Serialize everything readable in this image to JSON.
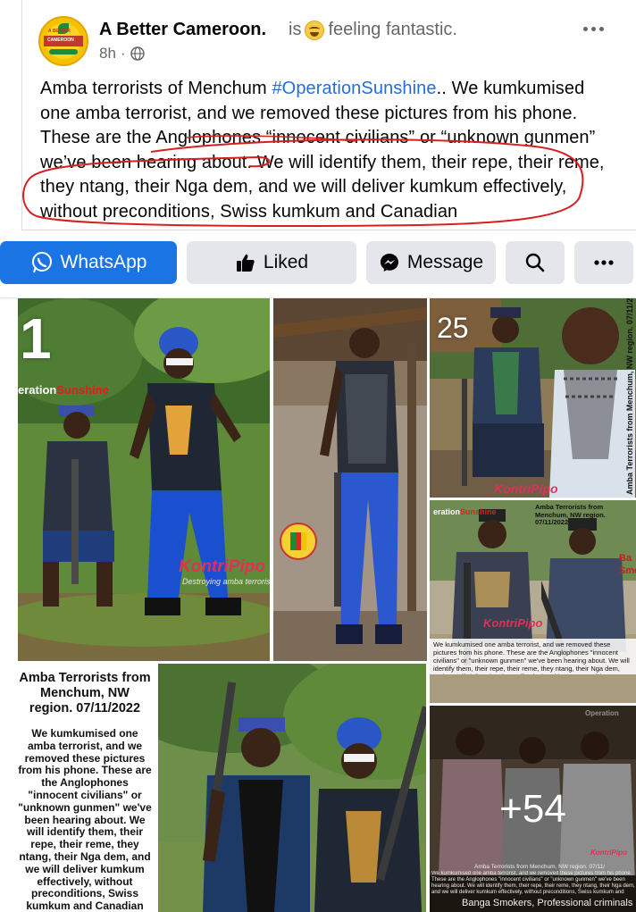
{
  "post": {
    "page_name": "A Better Cameroon.",
    "feeling_prefix": "is",
    "feeling_text": "feeling fantastic.",
    "timestamp": "8h",
    "avatar_text_top": "A BETTER",
    "avatar_text_bottom": "CAMEROON",
    "text_part1": "Amba terrorists of Menchum ",
    "hashtag": "#OperationSunshine",
    "text_part2": ".. We kumkumised one amba terrorist, and we removed these pictures from his phone. These are the Anglophones “innocent civilians” or “unknown gunmen” we’ve been hearing about. We will identify them, their repe, their reme, they ntang, their Nga dem, and we will deliver kumkum effectively, without preconditions, Swiss kumkum and Canadian"
  },
  "actions": {
    "whatsapp": "WhatsApp",
    "liked": "Liked",
    "message": "Message"
  },
  "photos": {
    "tile1_number": "1",
    "tile1_tag_white": "eration",
    "tile1_tag_red": "Sunshine",
    "watermark": "KontriPipo",
    "watermark_sub": "Destroying amba terrorism",
    "tile3_number": "25",
    "tile3_side": "Amba Terrorists from Menchum, NW region. 07/11/2022",
    "tile4_tag_white": "eration",
    "tile4_tag_red": "Sunshine",
    "tile4_header": "Amba Terrorists from Menchum, NW region. 07/11/2022",
    "tile4_caption": "We kumkumised one amba terrorist, and we removed these pictures from his phone. These are the Anglophones \"innocent civilians\" or \"unknown gunmen\" we've been hearing about. We will identify them, their repe, their reme, they ntang, their Nga dem, and we will deliver kumkum effectively, without preconditions, Swiss kumkum and Canadian kumkum.",
    "tile4_side": "Ba Smo",
    "info_title": "Amba Terrorists from Menchum, NW region. 07/11/2022",
    "info_body": "We kumkumised one amba terrorist, and we removed these pictures from his phone. These are the Anglophones \"innocent civilians\" or \"unknown gunmen\" we've been hearing about. We will identify them, their repe, their reme, they ntang, their Nga dem, and we will deliver kumkum effectively, without preconditions, Swiss kumkum and Canadian kumkum.",
    "tile6_tag": "Operation",
    "more_count": "+54",
    "tile6_caption_top": "Amba Terrorists from Menchum, NW region. 07/11/",
    "tile6_caption": "We kumkumised one amba terrorist, and we removed these pictures from his phone. These are the Anglophones \"innocent civilians\" or \"unknown gunmen\" we've been hearing about. We will identify them, their repe, their reme, they ntang, their Nga dem, and we will deliver kumkum effectively, without preconditions, Swiss kumkum and Canadian kumkum.",
    "tile6_bottom": "Banga Smokers, Professional criminals"
  },
  "colors": {
    "brand_blue": "#1b74e4",
    "hashtag_blue": "#216fdb",
    "secondary_button": "#e4e6eb",
    "annotation_red": "#d61f1f"
  }
}
